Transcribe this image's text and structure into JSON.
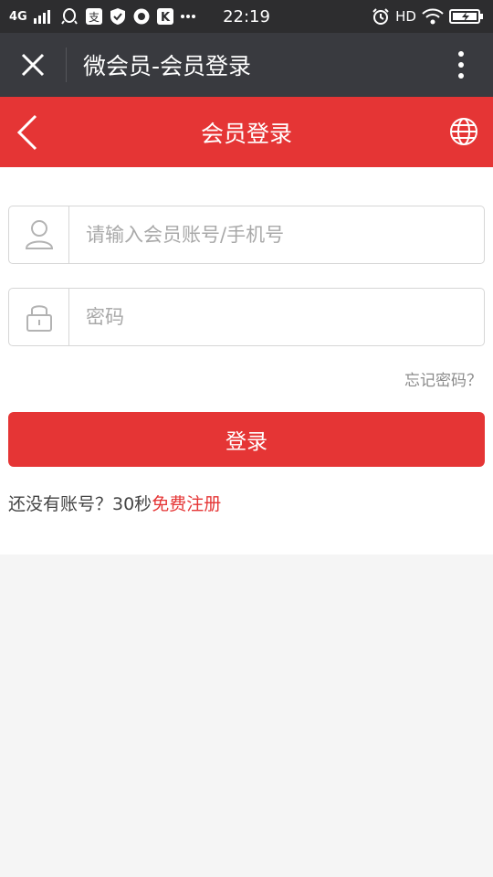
{
  "status_bar": {
    "network": "4G",
    "time": "22:19",
    "hd": "HD"
  },
  "wechat_bar": {
    "title": "微会员-会员登录"
  },
  "header": {
    "title": "会员登录"
  },
  "form": {
    "account_placeholder": "请输入会员账号/手机号",
    "account_value": "",
    "password_placeholder": "密码",
    "password_value": "",
    "forgot_label": "忘记密码？",
    "login_label": "登录",
    "register_prompt": "还没有账号？30秒",
    "register_link": "免费注册"
  },
  "icons": {
    "close": "close-icon",
    "more": "more-vertical-icon",
    "back": "chevron-left-icon",
    "globe": "globe-icon",
    "user": "user-icon",
    "lock": "lock-icon"
  },
  "colors": {
    "accent": "#e53535",
    "wechat_bar": "#393a3f",
    "status_bar": "#2d2d2f",
    "page_bg": "#f5f5f5"
  }
}
